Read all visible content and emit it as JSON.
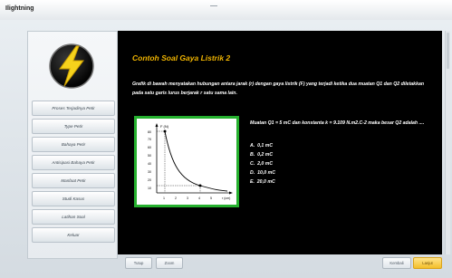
{
  "app": {
    "title": "Ilightning"
  },
  "sidebar": {
    "items": [
      {
        "label": "Proses Terjadinya Petir"
      },
      {
        "label": "Type Petir"
      },
      {
        "label": "Bahaya Petir"
      },
      {
        "label": "Antisipasi Bahaya Petir"
      },
      {
        "label": "Manfaat Petir"
      },
      {
        "label": "Studi Kasus"
      },
      {
        "label": "Latihan Soal"
      },
      {
        "label": "Keluar"
      }
    ]
  },
  "content": {
    "heading": "Contoh Soal Gaya Listrik 2",
    "intro": "Grafik di bawah menyatakan hubungan antara jarak (r) dengan gaya listrik (F) yang terjadi ketika dua muatan Q1 dan Q2 diletakkan pada satu garis lurus berjarak r satu sama lain.",
    "question": "Muatan Q1 = 5 mC dan konstanta k = 9.109 N.m2.C-2 maka besar Q2 adalah ....",
    "options": [
      {
        "letter": "A.",
        "text": "0,1  mC"
      },
      {
        "letter": "B.",
        "text": "0,2  mC"
      },
      {
        "letter": "C.",
        "text": "2,0  mC"
      },
      {
        "letter": "D.",
        "text": "10,0 mC"
      },
      {
        "letter": "E.",
        "text": "20,0 mC"
      }
    ],
    "graph": {
      "y_axis_label": "F (N)",
      "x_axis_label": "r (cm)",
      "y_ticks": [
        "80",
        "70",
        "60",
        "50",
        "40",
        "30",
        "20",
        "10"
      ],
      "x_ticks": [
        "1",
        "2",
        "3",
        "4",
        "5"
      ]
    }
  },
  "footer": {
    "left_buttons": [
      "Tutup",
      "Zoom"
    ],
    "right_buttons": [
      "Kembali",
      "Lanjut"
    ]
  },
  "colors": {
    "accent": "#f0b400",
    "figure_border": "#25b02e",
    "panel_bg": "#000000"
  }
}
